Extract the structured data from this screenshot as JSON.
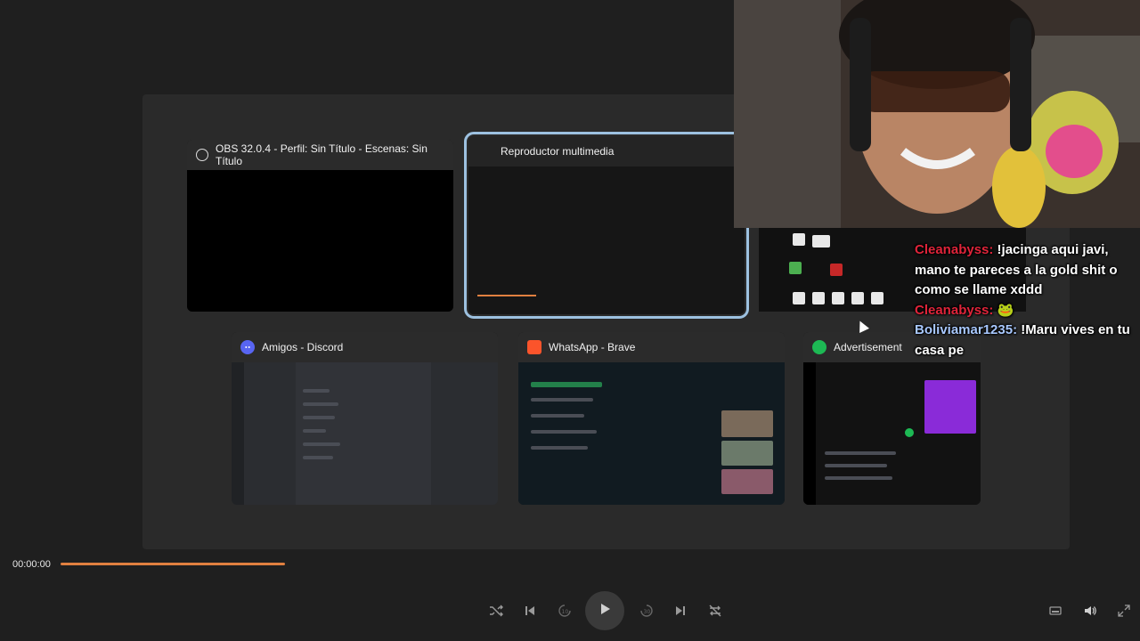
{
  "switcher": {
    "windows": [
      {
        "title": "OBS 32.0.4 - Perfil: Sin Título - Escenas: Sin Título",
        "icon": "obs-icon"
      },
      {
        "title": "Reproductor multimedia",
        "icon": "none",
        "selected": true
      },
      {
        "title": "Amigos - Discord",
        "icon": "discord-icon"
      },
      {
        "title": "WhatsApp - Brave",
        "icon": "brave-icon"
      },
      {
        "title": "Advertisement",
        "icon": "spotify-icon"
      }
    ]
  },
  "chat": {
    "messages": [
      {
        "user": "Cleanabyss:",
        "text": "!jacinga aqui javi, mano te pareces a la gold shit o como se llame xddd",
        "user_color": "#e0243a"
      },
      {
        "user": "Cleanabyss:",
        "text": "🐸",
        "user_color": "#e0243a"
      },
      {
        "user": "Boliviamar1235:",
        "text": "!Maru vives en tu casa pe",
        "user_color": "#a8c8ff"
      }
    ]
  },
  "player": {
    "time": "00:00:00",
    "progress": 0.21,
    "accent": "#e08040"
  },
  "controls": {
    "icons": [
      "shuffle-icon",
      "previous-icon",
      "rewind-10-icon",
      "play-icon",
      "forward-30-icon",
      "next-icon",
      "repeat-off-icon",
      "miniplayer-icon",
      "volume-icon",
      "fullscreen-icon"
    ]
  }
}
